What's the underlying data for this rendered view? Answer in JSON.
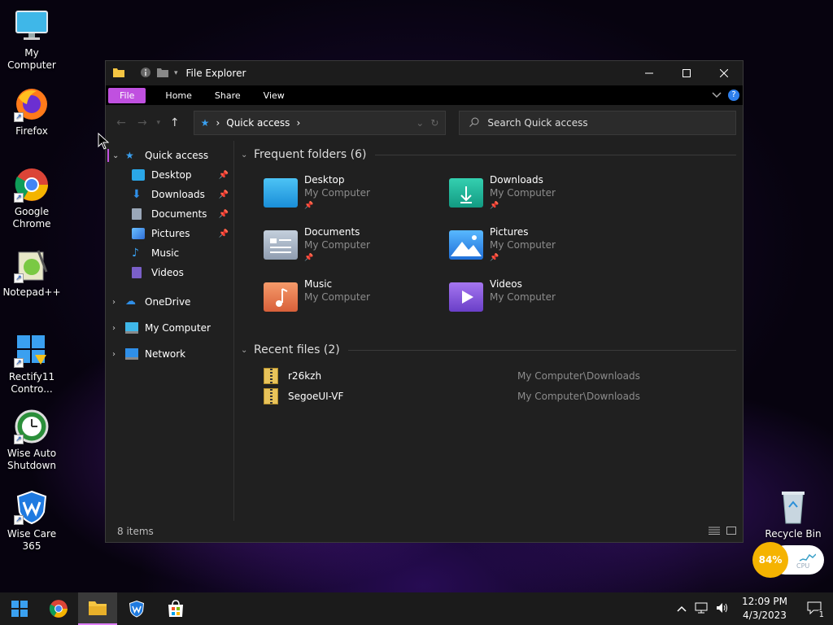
{
  "desktop": {
    "icons": [
      {
        "label": "My Computer"
      },
      {
        "label": "Firefox"
      },
      {
        "label": "Google Chrome"
      },
      {
        "label": "Notepad++"
      },
      {
        "label": "Rectify11 Contro..."
      },
      {
        "label": "Wise Auto Shutdown"
      },
      {
        "label": "Wise Care 365"
      }
    ],
    "recycle_bin": "Recycle Bin"
  },
  "window": {
    "title": "File Explorer",
    "ribbon": {
      "file": "File",
      "home": "Home",
      "share": "Share",
      "view": "View"
    },
    "address": {
      "path": "Quick access"
    },
    "search": {
      "placeholder": "Search Quick access"
    },
    "sidebar": {
      "quick_access": "Quick access",
      "pinned": [
        {
          "label": "Desktop",
          "pinned": true
        },
        {
          "label": "Downloads",
          "pinned": true
        },
        {
          "label": "Documents",
          "pinned": true
        },
        {
          "label": "Pictures",
          "pinned": true
        },
        {
          "label": "Music",
          "pinned": false
        },
        {
          "label": "Videos",
          "pinned": false
        }
      ],
      "onedrive": "OneDrive",
      "my_computer": "My Computer",
      "network": "Network"
    },
    "frequent": {
      "heading": "Frequent folders (6)",
      "items": [
        {
          "name": "Desktop",
          "location": "My Computer",
          "color": "#2aa7e8"
        },
        {
          "name": "Downloads",
          "location": "My Computer",
          "color": "#1fb59a"
        },
        {
          "name": "Documents",
          "location": "My Computer",
          "color": "#9aa7b8"
        },
        {
          "name": "Pictures",
          "location": "My Computer",
          "color": "#2f8fe8"
        },
        {
          "name": "Music",
          "location": "My Computer",
          "color": "#e57a4a"
        },
        {
          "name": "Videos",
          "location": "My Computer",
          "color": "#8a4fd8"
        }
      ]
    },
    "recent": {
      "heading": "Recent files (2)",
      "items": [
        {
          "name": "r26kzh",
          "location": "My Computer\\Downloads"
        },
        {
          "name": "SegoeUI-VF",
          "location": "My Computer\\Downloads"
        }
      ]
    },
    "status": {
      "count": "8 items"
    }
  },
  "widget": {
    "cpu_percent": "84%",
    "cpu_label": "CPU"
  },
  "taskbar": {
    "time": "12:09 PM",
    "date": "4/3/2023",
    "notification_count": "1"
  },
  "colors": {
    "accent": "#c050e0",
    "window_bg": "#202020",
    "cpu_badge": "#f5b301"
  }
}
